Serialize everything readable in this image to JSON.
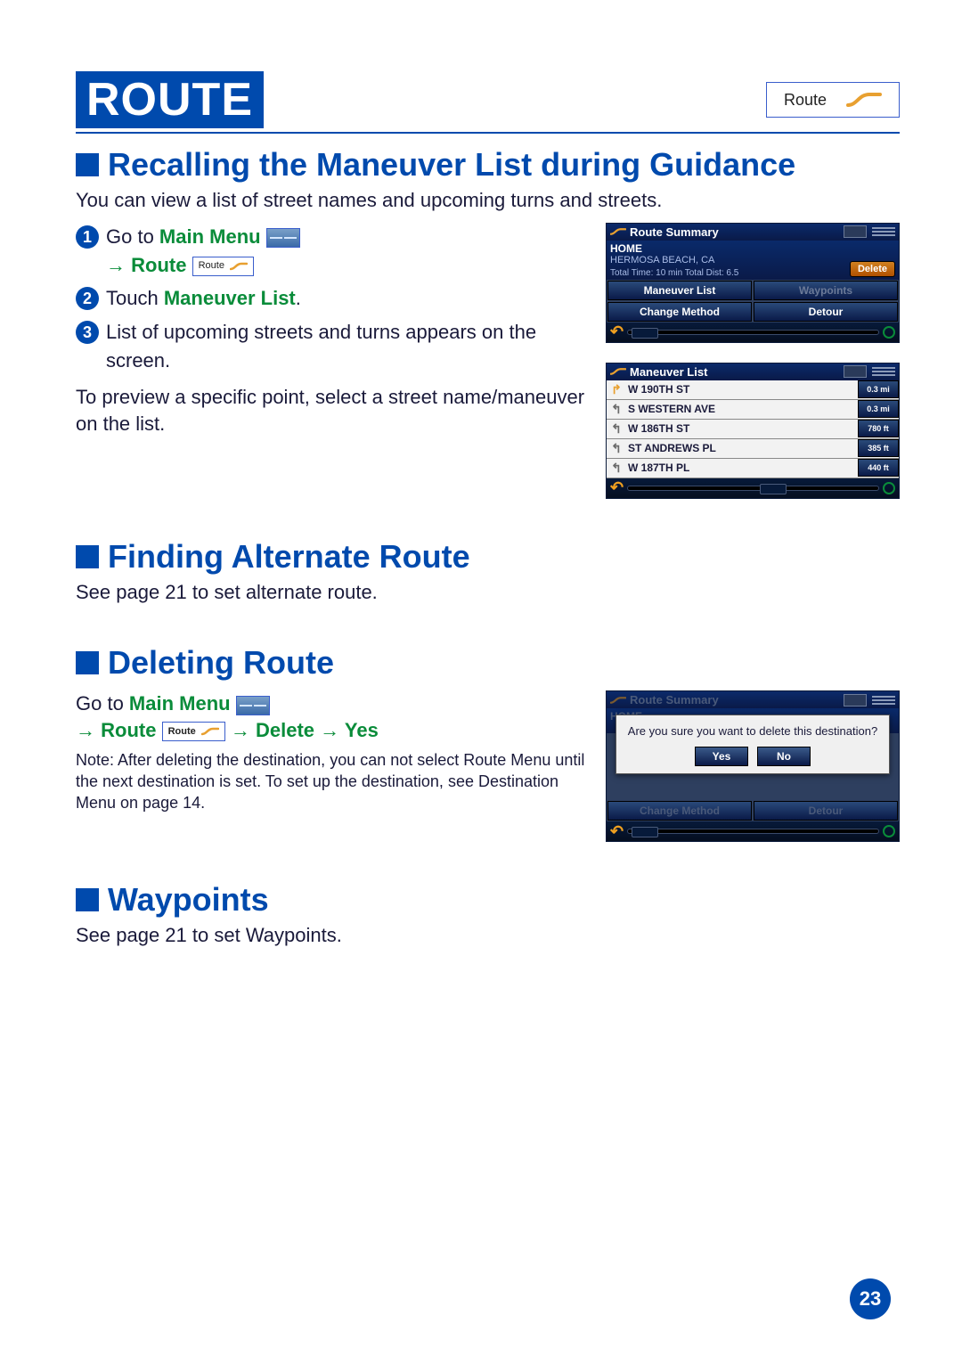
{
  "page_number": "23",
  "header": {
    "title": "ROUTE",
    "tab_label": "Route"
  },
  "sections": {
    "recall": {
      "heading": "Recalling the Maneuver List during Guidance",
      "intro": "You can view a list of street names and upcoming turns and streets.",
      "step1_a": "Go to ",
      "step1_main_menu": "Main Menu",
      "step1_b_arrow": "→",
      "step1_route": "Route",
      "route_mini_label": "Route",
      "step2_a": "Touch ",
      "step2_link": "Maneuver List",
      "step2_b": ".",
      "step3": "List of upcoming streets and turns appears on the screen.",
      "para": "To preview a specific point, select a street name/maneuver on the list."
    },
    "alternate": {
      "heading": "Finding Alternate Route",
      "text": "See page 21 to set alternate route."
    },
    "deleting": {
      "heading": "Deleting Route",
      "line1_a": "Go to ",
      "line1_main_menu": "Main Menu",
      "line2_arrow1": "→",
      "line2_route": "Route",
      "route_mini_label": "Route",
      "line2_arrow2": "→",
      "line2_delete": "Delete",
      "line2_arrow3": "→",
      "line2_yes": "Yes",
      "note": "Note: After deleting the destination, you can not select Route Menu until the next destination is set. To set up the destination, see Destination Menu on page 14."
    },
    "waypoints": {
      "heading": "Waypoints",
      "text": "See page 21 to set Waypoints."
    }
  },
  "devices": {
    "route_summary": {
      "title": "Route Summary",
      "dest_label": "HOME",
      "dest_city": "HERMOSA BEACH, CA",
      "totals": "Total Time: 10 min  Total Dist: 6.5",
      "delete": "Delete",
      "btn_maneuver": "Maneuver List",
      "btn_waypoints": "Waypoints",
      "btn_change": "Change Method",
      "btn_detour": "Detour"
    },
    "maneuver_list": {
      "title": "Maneuver List",
      "items": [
        {
          "icon": "right",
          "street": "W 190TH ST",
          "dist": "0.3 mi"
        },
        {
          "icon": "left",
          "street": "S WESTERN AVE",
          "dist": "0.3 mi"
        },
        {
          "icon": "left",
          "street": "W 186TH ST",
          "dist": "780 ft"
        },
        {
          "icon": "left",
          "street": "ST ANDREWS PL",
          "dist": "385 ft"
        },
        {
          "icon": "left",
          "street": "W 187TH PL",
          "dist": "440 ft"
        }
      ]
    },
    "delete_dialog": {
      "title": "Route Summary",
      "dest_label": "HOME",
      "message": "Are you sure you want to delete this destination?",
      "yes": "Yes",
      "no": "No",
      "btn_change": "Change Method",
      "btn_detour": "Detour"
    }
  }
}
